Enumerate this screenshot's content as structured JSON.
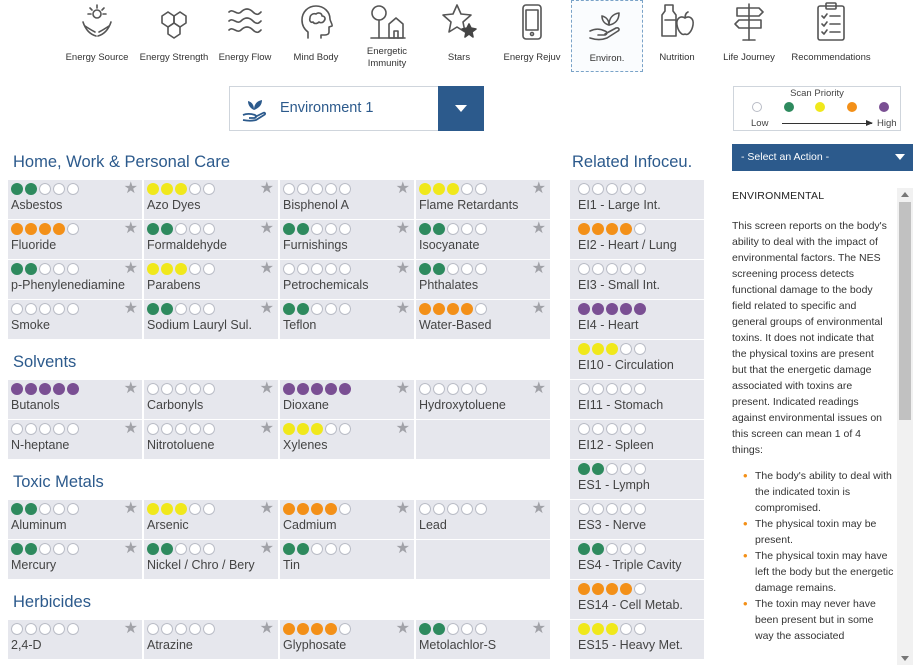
{
  "nav": {
    "items": [
      {
        "id": "energy-source",
        "label": "Energy Source",
        "icon": "hands-sun-icon",
        "active": false
      },
      {
        "id": "energy-strength",
        "label": "Energy Strength",
        "icon": "hexagons-icon",
        "active": false
      },
      {
        "id": "energy-flow",
        "label": "Energy Flow",
        "icon": "waves-icon",
        "active": false
      },
      {
        "id": "mind-body",
        "label": "Mind Body",
        "icon": "head-brain-icon",
        "active": false
      },
      {
        "id": "energetic-immunity",
        "label": "Energetic Immunity",
        "icon": "tree-house-icon",
        "active": false
      },
      {
        "id": "stars",
        "label": "Stars",
        "icon": "stars-icon",
        "active": false
      },
      {
        "id": "energy-rejuv",
        "label": "Energy Rejuv",
        "icon": "phone-icon",
        "active": false
      },
      {
        "id": "environ",
        "label": "Environ.",
        "icon": "hand-plant-icon",
        "active": true
      },
      {
        "id": "nutrition",
        "label": "Nutrition",
        "icon": "bottle-apple-icon",
        "active": false
      },
      {
        "id": "life-journey",
        "label": "Life Journey",
        "icon": "signpost-icon",
        "active": false
      },
      {
        "id": "recommendations",
        "label": "Recommendations",
        "icon": "clipboard-checklist-icon",
        "active": false
      }
    ]
  },
  "environment_selector": {
    "label": "Environment 1",
    "icon": "hand-plant-icon"
  },
  "scan_priority": {
    "title": "Scan Priority",
    "low_label": "Low",
    "high_label": "High",
    "levels": [
      "#ffffff",
      "#2e8a5e",
      "#f0e81b",
      "#f39018",
      "#7a4f93"
    ]
  },
  "colors": {
    "accent": "#2c5a8c",
    "green": "#2e8a5e",
    "yellow": "#f0e81b",
    "orange": "#f39018",
    "purple": "#7a4f93",
    "cell_bg": "#e6e7ed"
  },
  "sections": [
    {
      "title": "Home, Work & Personal Care",
      "rows": [
        [
          {
            "label": "Asbestos",
            "level": "green",
            "count": 2
          },
          {
            "label": "Azo Dyes",
            "level": "yellow",
            "count": 3
          },
          {
            "label": "Bisphenol A",
            "level": "none",
            "count": 0
          },
          {
            "label": "Flame Retardants",
            "level": "yellow",
            "count": 3
          }
        ],
        [
          {
            "label": "Fluoride",
            "level": "orange",
            "count": 4
          },
          {
            "label": "Formaldehyde",
            "level": "green",
            "count": 2
          },
          {
            "label": "Furnishings",
            "level": "green",
            "count": 2
          },
          {
            "label": "Isocyanate",
            "level": "green",
            "count": 2
          }
        ],
        [
          {
            "label": "p-Phenylenediamine",
            "level": "green",
            "count": 2
          },
          {
            "label": "Parabens",
            "level": "yellow",
            "count": 3
          },
          {
            "label": "Petrochemicals",
            "level": "none",
            "count": 0
          },
          {
            "label": "Phthalates",
            "level": "green",
            "count": 2
          }
        ],
        [
          {
            "label": "Smoke",
            "level": "none",
            "count": 0
          },
          {
            "label": "Sodium Lauryl Sul.",
            "level": "green",
            "count": 2
          },
          {
            "label": "Teflon",
            "level": "green",
            "count": 2
          },
          {
            "label": "Water-Based",
            "level": "orange",
            "count": 4
          }
        ]
      ]
    },
    {
      "title": "Solvents",
      "rows": [
        [
          {
            "label": "Butanols",
            "level": "purple",
            "count": 5
          },
          {
            "label": "Carbonyls",
            "level": "none",
            "count": 0
          },
          {
            "label": "Dioxane",
            "level": "purple",
            "count": 5
          },
          {
            "label": "Hydroxytoluene",
            "level": "none",
            "count": 0
          }
        ],
        [
          {
            "label": "N-heptane",
            "level": "none",
            "count": 0
          },
          {
            "label": "Nitrotoluene",
            "level": "none",
            "count": 0
          },
          {
            "label": "Xylenes",
            "level": "yellow",
            "count": 3
          },
          null
        ]
      ]
    },
    {
      "title": "Toxic Metals",
      "rows": [
        [
          {
            "label": "Aluminum",
            "level": "green",
            "count": 2
          },
          {
            "label": "Arsenic",
            "level": "yellow",
            "count": 3
          },
          {
            "label": "Cadmium",
            "level": "orange",
            "count": 4
          },
          {
            "label": "Lead",
            "level": "none",
            "count": 0
          }
        ],
        [
          {
            "label": "Mercury",
            "level": "green",
            "count": 2
          },
          {
            "label": "Nickel / Chro / Bery",
            "level": "green",
            "count": 2
          },
          {
            "label": "Tin",
            "level": "green",
            "count": 2
          },
          null
        ]
      ]
    },
    {
      "title": "Herbicides",
      "rows": [
        [
          {
            "label": "2,4-D",
            "level": "none",
            "count": 0
          },
          {
            "label": "Atrazine",
            "level": "none",
            "count": 0
          },
          {
            "label": "Glyphosate",
            "level": "orange",
            "count": 4
          },
          {
            "label": "Metolachlor-S",
            "level": "green",
            "count": 2
          }
        ]
      ]
    }
  ],
  "related": {
    "title": "Related Infoceu.",
    "items": [
      {
        "label": "EI1 - Large Int.",
        "level": "none",
        "count": 0
      },
      {
        "label": "EI2 - Heart / Lung",
        "level": "orange",
        "count": 4
      },
      {
        "label": "EI3 - Small Int.",
        "level": "none",
        "count": 0
      },
      {
        "label": "EI4 - Heart",
        "level": "purple",
        "count": 5
      },
      {
        "label": "EI10 - Circulation",
        "level": "yellow",
        "count": 3
      },
      {
        "label": "EI11 - Stomach",
        "level": "none",
        "count": 0
      },
      {
        "label": "EI12 - Spleen",
        "level": "none",
        "count": 0
      },
      {
        "label": "ES1 - Lymph",
        "level": "green",
        "count": 2
      },
      {
        "label": "ES3 - Nerve",
        "level": "none",
        "count": 0
      },
      {
        "label": "ES4 - Triple Cavity",
        "level": "green",
        "count": 2
      },
      {
        "label": "ES14 - Cell Metab.",
        "level": "orange",
        "count": 4
      },
      {
        "label": "ES15 - Heavy Met.",
        "level": "yellow",
        "count": 3
      }
    ]
  },
  "action_select": {
    "label": "- Select an Action -"
  },
  "info": {
    "heading": "ENVIRONMENTAL",
    "paragraph": "This screen reports on the body's ability to deal with the impact of environmental factors. The NES screening process detects functional damage to the body field related to specific and general groups of environmental toxins. It does not indicate that the physical toxins are present but that the energetic damage associated with toxins are present. Indicated readings against environmental issues on this screen can mean 1 of 4 things:",
    "bullets": [
      "The body's ability to deal with the indicated toxin is compromised.",
      "The physical toxin may be present.",
      "The physical toxin may have left the body but the energetic damage remains.",
      "The toxin may never have been present but in some way the associated"
    ]
  }
}
